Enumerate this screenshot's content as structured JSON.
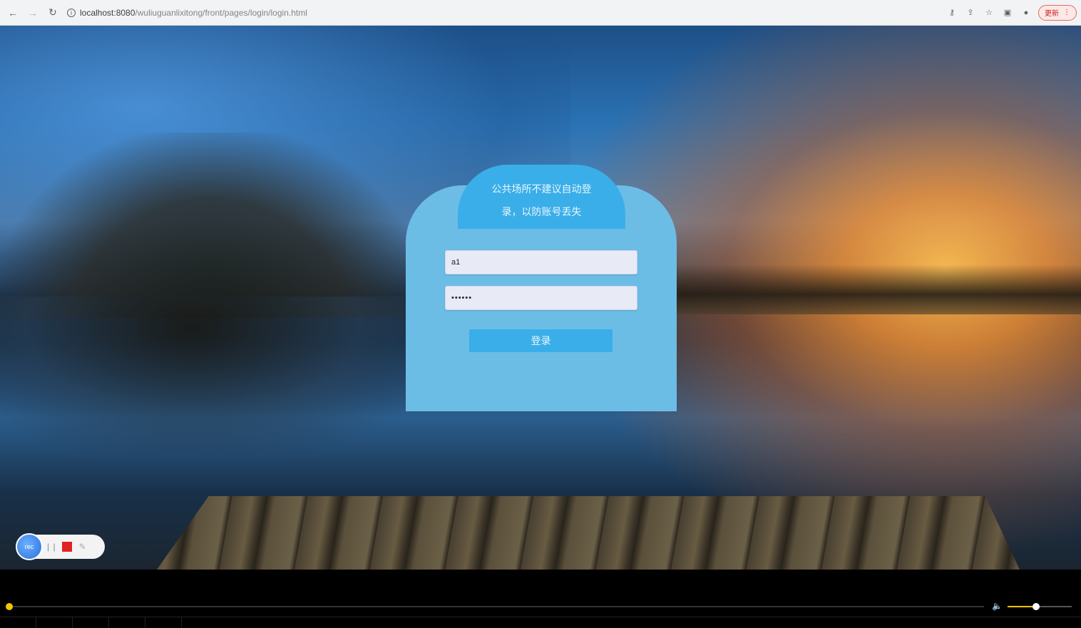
{
  "browser": {
    "url_host": "localhost:8080",
    "url_path": "/wuliuguanlixitong/front/pages/login/login.html",
    "update_label": "更新",
    "icons": [
      "back-icon",
      "forward-icon",
      "reload-icon",
      "info-icon",
      "key-icon",
      "share-icon",
      "star-icon",
      "sidebar-icon",
      "profile-icon",
      "more-icon"
    ]
  },
  "login": {
    "notice_line1": "公共场所不建议自动登",
    "notice_line2": "录，以防账号丢失",
    "username_value": "a1",
    "password_value": "••••••",
    "login_button_label": "登录"
  },
  "recorder": {
    "avatar_label": "rec",
    "pause_symbol": "| |",
    "pen_symbol": "✎"
  },
  "player": {
    "volume_symbol": "🔈"
  },
  "colors": {
    "card_bg": "#6cbde6",
    "accent": "#3aaee8",
    "progress": "#f5c400"
  }
}
